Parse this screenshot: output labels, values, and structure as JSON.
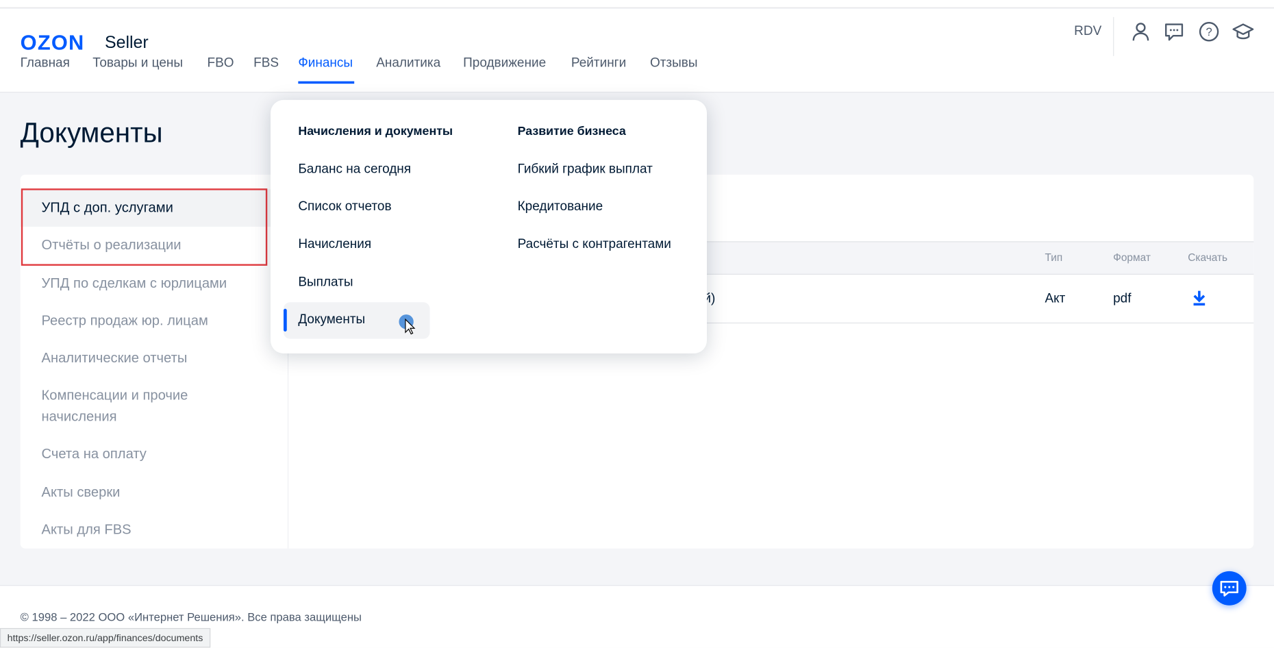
{
  "header": {
    "logo": "OZON",
    "logo_suffix": "Seller",
    "user": "RDV",
    "icons": [
      "user-icon",
      "chat-icon",
      "help-icon",
      "education-icon"
    ]
  },
  "nav": [
    {
      "label": "Главная"
    },
    {
      "label": "Товары и цены"
    },
    {
      "label": "FBO"
    },
    {
      "label": "FBS"
    },
    {
      "label": "Финансы",
      "active": true
    },
    {
      "label": "Аналитика"
    },
    {
      "label": "Продвижение"
    },
    {
      "label": "Рейтинги"
    },
    {
      "label": "Отзывы"
    }
  ],
  "page_title": "Документы",
  "sidebar": [
    {
      "label": "УПД с доп. услугами",
      "active": true
    },
    {
      "label": "Отчёты о реализации"
    },
    {
      "label": "УПД по сделкам с юрлицами"
    },
    {
      "label": "Реестр продаж юр. лицам"
    },
    {
      "label": "Аналитические отчеты"
    },
    {
      "label": "Компенсации и прочие начисления"
    },
    {
      "label": "Счета на оплату"
    },
    {
      "label": "Акты сверки"
    },
    {
      "label": "Акты для FBS"
    }
  ],
  "table": {
    "headers": {
      "type": "Тип",
      "format": "Формат",
      "download": "Скачать"
    },
    "rows": [
      {
        "name_partial": "ций)",
        "type": "Акт",
        "format": "pdf"
      }
    ]
  },
  "dropdown": {
    "col1": {
      "heading": "Начисления и документы",
      "items": [
        "Баланс на сегодня",
        "Список отчетов",
        "Начисления",
        "Выплаты",
        "Документы"
      ]
    },
    "col2": {
      "heading": "Развитие бизнеса",
      "items": [
        "Гибкий график выплат",
        "Кредитование",
        "Расчёты с контрагентами"
      ]
    }
  },
  "footer": {
    "copyright": "© 1998 – 2022 ООО «Интернет Решения». Все права защищены"
  },
  "status_url": "https://seller.ozon.ru/app/finances/documents",
  "colors": {
    "accent": "#005bff",
    "highlight": "#e0393e"
  }
}
